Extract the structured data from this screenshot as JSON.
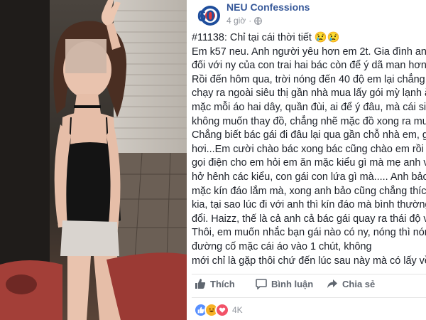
{
  "post": {
    "page_name": "NEU Confessions",
    "time": "4 giờ",
    "lines": [
      "#11138: Chỉ tại cái thời tiết 😢😢",
      "Em k57 neu. Anh người yêu hơn em 2t. Gia đình anh",
      "đối với ny của con trai hai bác còn để ý dã man hơn",
      "Rồi đến hôm qua, trời nóng đến 40 độ em lại chẳng",
      "chạy ra ngoài siêu thị gần nhà mua lấy gói mỳ lạnh ă",
      "mặc mỗi áo hai dây, quần đùi, ai để ý đâu, mà cái siê",
      "không muốn thay đồ, chẳng nhẽ mặc đồ xong ra mu",
      "Chẳng biết bác gái đi đâu lại qua gần chỗ nhà em, g",
      "hơi...Em cười chào bác xong bác cũng chào em rồi b",
      "gọi điện cho em hỏi em ăn mặc kiểu gì mà mẹ anh v",
      "hở hênh các kiểu, con gái con lứa gì mà..... Anh bảo",
      "mặc kín đáo lắm mà, xong anh bảo cũng chẳng thích",
      "kia, tại sao lúc đi với anh thì kín đáo mà bình thường",
      "đổi. Haizz, thế là cả anh cả bác gái quay ra thái độ v",
      "Thôi, em muốn nhắc bạn gái nào có ny, nóng thì nón",
      "đường cố mặc cái áo vào 1 chút, không",
      "mới chỉ là gặp thôi chứ đến lúc sau này mà có lấy về"
    ]
  },
  "actions": {
    "like": "Thích",
    "comment": "Bình luận",
    "share": "Chia sẻ"
  },
  "reactions": {
    "count": "4K",
    "icons": [
      "like-reaction",
      "haha-reaction",
      "love-reaction"
    ]
  },
  "logo": {
    "badge_text": "60"
  },
  "colors": {
    "link": "#365899",
    "text": "#1d2129",
    "muted": "#90949c",
    "action": "#616770",
    "like": "#5890ff",
    "love": "#f25268",
    "haha": "#f7b125"
  }
}
